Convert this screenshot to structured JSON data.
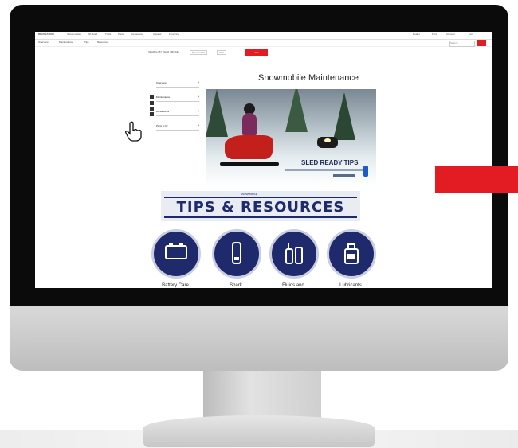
{
  "screen": {
    "top_nav": {
      "items": [
        "RECREATION",
        "Snowmobiles",
        "Off-Road",
        "Trails",
        "Parts",
        "Accessories",
        "Apparel",
        "Financing"
      ],
      "right_links": [
        "Dealer",
        "Find",
        "Account",
        "Cart"
      ]
    },
    "sub_nav": {
      "items": [
        "Overview",
        "Maintenance",
        "Tips",
        "Resources"
      ],
      "search_placeholder": "Search"
    },
    "find_bar": {
      "segments": [
        "SEARCH BY YEAR / MODEL",
        "Snowmobile",
        "Year"
      ],
      "button": "GO"
    },
    "page_title": "Snowmobile Maintenance",
    "side_menu": {
      "items": [
        "Overview",
        "Maintenance",
        "Accessories",
        "Parts & Oil"
      ]
    },
    "hero": {
      "caption": "SLED READY TIPS"
    },
    "tips_banner": {
      "kicker": "SNOWMOBILE",
      "title": "TIPS & RESOURCES"
    },
    "categories": [
      {
        "label": "Battery Care",
        "icon": "battery-icon"
      },
      {
        "label": "Spark",
        "icon": "spark-plug-icon"
      },
      {
        "label": "Fluids and",
        "icon": "fluid-bottles-icon"
      },
      {
        "label": "Lubricants",
        "icon": "oil-can-icon"
      }
    ]
  },
  "colors": {
    "accent_red": "#e31b23",
    "brand_navy": "#1f2a6c",
    "bezel": "#0b0b0b"
  }
}
